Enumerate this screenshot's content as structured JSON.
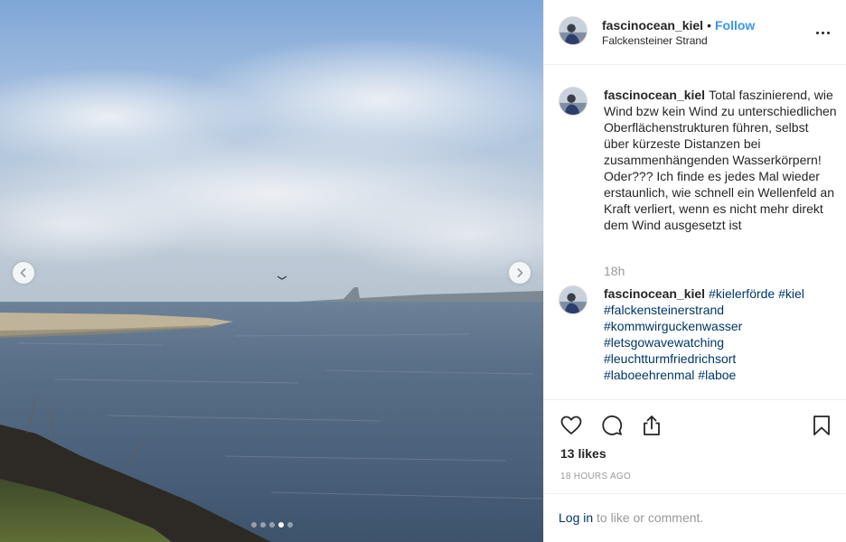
{
  "post": {
    "username": "fascinocean_kiel",
    "separator": "•",
    "follow_label": "Follow",
    "location": "Falckensteiner Strand"
  },
  "caption": {
    "username": "fascinocean_kiel",
    "text": "Total faszinierend, wie Wind bzw kein Wind zu unterschiedlichen Oberflächenstrukturen führen, selbst über kürzeste Distanzen bei zusammenhängenden Wasserkörpern! Oder??? Ich finde es jedes Mal wieder erstaunlich, wie schnell ein Wellenfeld an Kraft verliert, wenn es nicht mehr direkt dem Wind ausgesetzt ist",
    "time": "18h"
  },
  "hashtag_comment": {
    "username": "fascinocean_kiel",
    "tags": [
      "#kielerförde",
      "#kiel",
      "#falckensteinerstrand",
      "#kommwirguckenwasser",
      "#letsgowavewatching",
      "#leuchtturmfriedrichsort",
      "#laboeehrenmal",
      "#laboe"
    ]
  },
  "engagement": {
    "likes": "13 likes",
    "age": "18 HOURS AGO"
  },
  "login": {
    "link": "Log in",
    "rest": " to like or comment."
  },
  "carousel": {
    "slide_count": 5,
    "active_index": 3
  },
  "icons": {
    "like": "heart-icon",
    "comment": "comment-icon",
    "share": "share-icon",
    "save": "bookmark-icon",
    "more": "more-options-icon",
    "prev": "chevron-left-icon",
    "next": "chevron-right-icon"
  },
  "colors": {
    "link_blue": "#3897f0",
    "hashtag": "#003569",
    "muted": "#999999",
    "text": "#262626"
  }
}
